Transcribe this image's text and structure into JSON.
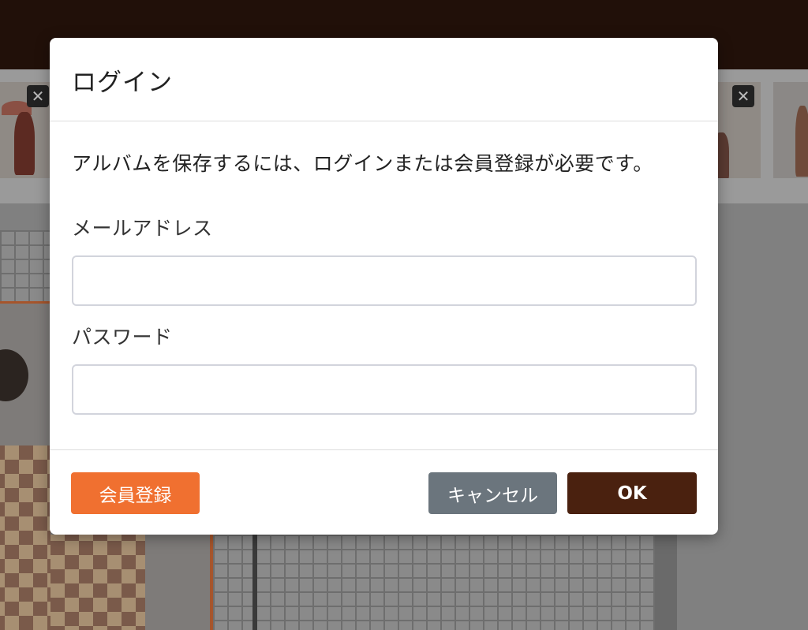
{
  "colors": {
    "topbar": "#211009",
    "register_button": "#f07030",
    "cancel_button": "#6b757d",
    "ok_button": "#4a210f"
  },
  "background": {
    "close_icon_glyph": "✕"
  },
  "modal": {
    "title": "ログイン",
    "message": "アルバムを保存するには、ログインまたは会員登録が必要です。",
    "email": {
      "label": "メールアドレス",
      "value": "",
      "placeholder": ""
    },
    "password": {
      "label": "パスワード",
      "value": "",
      "placeholder": ""
    },
    "buttons": {
      "register": "会員登録",
      "cancel": "キャンセル",
      "ok": "OK"
    }
  }
}
